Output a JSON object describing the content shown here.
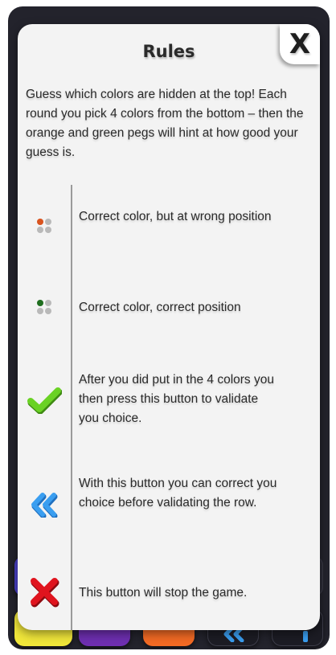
{
  "modal": {
    "title": "Rules",
    "close_label": "X",
    "intro": "Guess which colors are hidden at the top! Each round you pick 4 colors from the bottom – then the orange and green pegs will hint at how good your guess is."
  },
  "rules": [
    {
      "icon": "orange-peg-icon",
      "text": "Correct color, but at wrong position"
    },
    {
      "icon": "green-peg-icon",
      "text": "Correct color, correct position"
    },
    {
      "icon": "checkmark-icon",
      "text": "After you did put in the 4 colors you then press this button to validate you choice."
    },
    {
      "icon": "double-chevron-left-icon",
      "text": "With this button you can correct you choice before validating the row."
    },
    {
      "icon": "cross-icon",
      "text": "This button will stop the game."
    }
  ],
  "colors": {
    "peg_orange": "#d9531e",
    "peg_green": "#1f6e1f",
    "peg_grey": "#b9b9b9",
    "check_green": "#5ac81e",
    "undo_blue": "#3a9ef0",
    "cross_red": "#e0141e",
    "bottom_yellow": "#f0e63a",
    "bottom_purple": "#6e2fb0",
    "bottom_orange": "#f26a24"
  },
  "bottom_bar": {
    "buttons": [
      "yellow-color-button",
      "purple-color-button",
      "orange-color-button",
      "undo-button",
      "info-button"
    ]
  }
}
